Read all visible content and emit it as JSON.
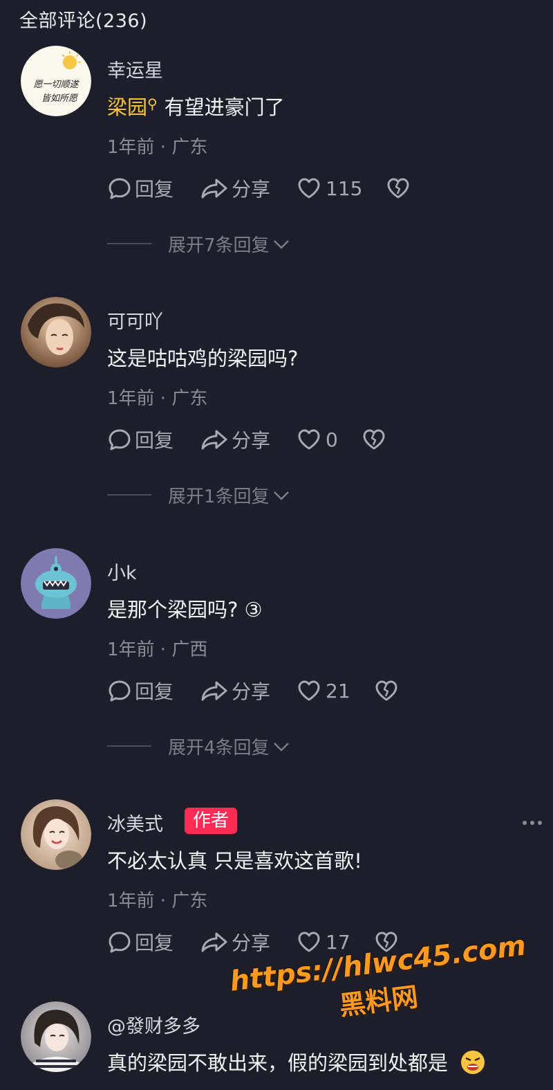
{
  "header": {
    "title": "全部评论(236)"
  },
  "actions": {
    "reply_label": "回复",
    "share_label": "分享"
  },
  "comments": [
    {
      "user": "幸运星",
      "keyword": "梁园",
      "text": "有望进豪门了",
      "time": "1年前",
      "location": "广东",
      "likes": "115",
      "expand": "展开7条回复",
      "avatar_text": "愿一切顺遂 皆如所愿"
    },
    {
      "user": "可可吖",
      "text": "这是咕咕鸡的梁园吗?",
      "time": "1年前",
      "location": "广东",
      "likes": "0",
      "expand": "展开1条回复"
    },
    {
      "user": "小k",
      "text": "是那个梁园吗? ③",
      "time": "1年前",
      "location": "广西",
      "likes": "21",
      "expand": "展开4条回复"
    },
    {
      "user": "冰美式",
      "badge": "作者",
      "text": "不必太认真 只是喜欢这首歌!",
      "time": "1年前",
      "location": "广东",
      "likes": "17"
    },
    {
      "user": "@發财多多",
      "text": "真的梁园不敢出来，假的梁园到处都是"
    }
  ],
  "watermark": {
    "url": "https://hlwc45.com",
    "name": "黑料网"
  },
  "colors": {
    "background": "#1d1e29",
    "keyword": "#f7c640",
    "author_badge": "#fe2c55",
    "watermark": "#ff9a1f"
  }
}
